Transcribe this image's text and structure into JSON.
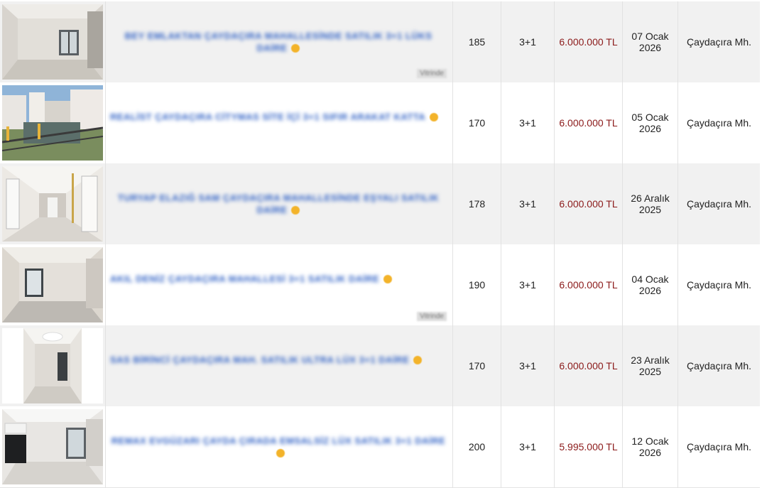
{
  "listings": [
    {
      "title": "BEY EMLAKTAN ÇAYDAÇIRA MAHALLESİNDE SATILIK 3+1 LÜKS DAİRE",
      "m2": "185",
      "rooms": "3+1",
      "price": "6.000.000 TL",
      "date_day": "07 Ocak",
      "date_year": "2026",
      "location": "Çaydaçıra Mh.",
      "featured": "Vitrinde",
      "image": "empty-room-photo",
      "highlight": "alt"
    },
    {
      "title": "REALİST ÇAYDAÇIRA CİTYMAS SİTE İÇİ 3+1 SIFIR ARAKAT KATTA",
      "m2": "170",
      "rooms": "3+1",
      "price": "6.000.000 TL",
      "date_day": "05 Ocak",
      "date_year": "2026",
      "location": "Çaydaçıra Mh.",
      "featured": "",
      "image": "building-exterior-photo",
      "highlight": "plain"
    },
    {
      "title": "TURYAP ELAZIĞ SAM ÇAYDAÇIRA MAHALLESİNDE EŞYALI SATILIK DAİRE",
      "m2": "178",
      "rooms": "3+1",
      "price": "6.000.000 TL",
      "date_day": "26 Aralık",
      "date_year": "2025",
      "location": "Çaydaçıra Mh.",
      "featured": "",
      "image": "hallway-photo",
      "highlight": "alt"
    },
    {
      "title": "AKIL DENİZ ÇAYDAÇIRA MAHALLESİ 3+1 SATILIK DAİRE",
      "m2": "190",
      "rooms": "3+1",
      "price": "6.000.000 TL",
      "date_day": "04 Ocak",
      "date_year": "2026",
      "location": "Çaydaçıra Mh.",
      "featured": "Vitrinde",
      "image": "empty-room-photo",
      "highlight": "plain"
    },
    {
      "title": "SAS BİRİNCİ ÇAYDAÇIRA MAH. SATILIK ULTRA LÜX 3+1 DAİRE",
      "m2": "170",
      "rooms": "3+1",
      "price": "6.000.000 TL",
      "date_day": "23 Aralık",
      "date_year": "2025",
      "location": "Çaydaçıra Mh.",
      "featured": "",
      "image": "interior-portrait-photo",
      "highlight": "alt"
    },
    {
      "title": "REMAX EVGÜZARI ÇAYDA ÇIRADA EMSALSİZ LÜX SATILIK 3+1 DAİRE",
      "m2": "200",
      "rooms": "3+1",
      "price": "5.995.000 TL",
      "date_day": "12 Ocak",
      "date_year": "2026",
      "location": "Çaydaçıra Mh.",
      "featured": "",
      "image": "kitchen-photo",
      "highlight": "plain"
    }
  ],
  "colors": {
    "price": "#8b1a1a",
    "title": "#2d5fc4",
    "row_alt": "#f1f1f1",
    "row_plain": "#ffffff",
    "star": "#f3b32a"
  }
}
